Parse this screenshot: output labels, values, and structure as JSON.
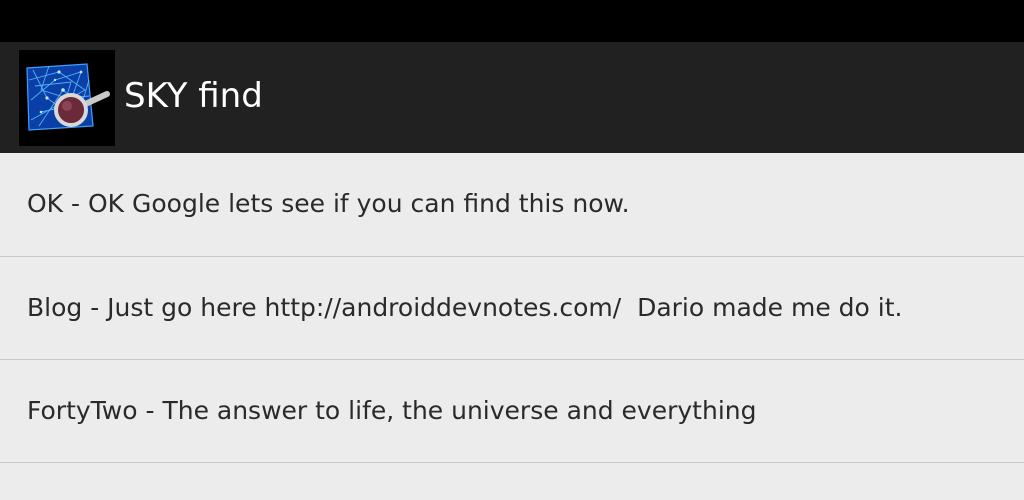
{
  "app": {
    "title": "SKY find",
    "icon": "sky-magnifier-icon"
  },
  "colors": {
    "status_bar": "#000000",
    "action_bar": "#212121",
    "list_background": "#ececec",
    "divider": "#c8c8c8",
    "text": "#2a2a2a"
  },
  "list": {
    "items": [
      {
        "label": "OK - OK Google lets see if you can find this now."
      },
      {
        "label": "Blog - Just go here http://androiddevnotes.com/  Dario made me do it."
      },
      {
        "label": "FortyTwo - The answer to life, the universe and everything"
      }
    ]
  }
}
